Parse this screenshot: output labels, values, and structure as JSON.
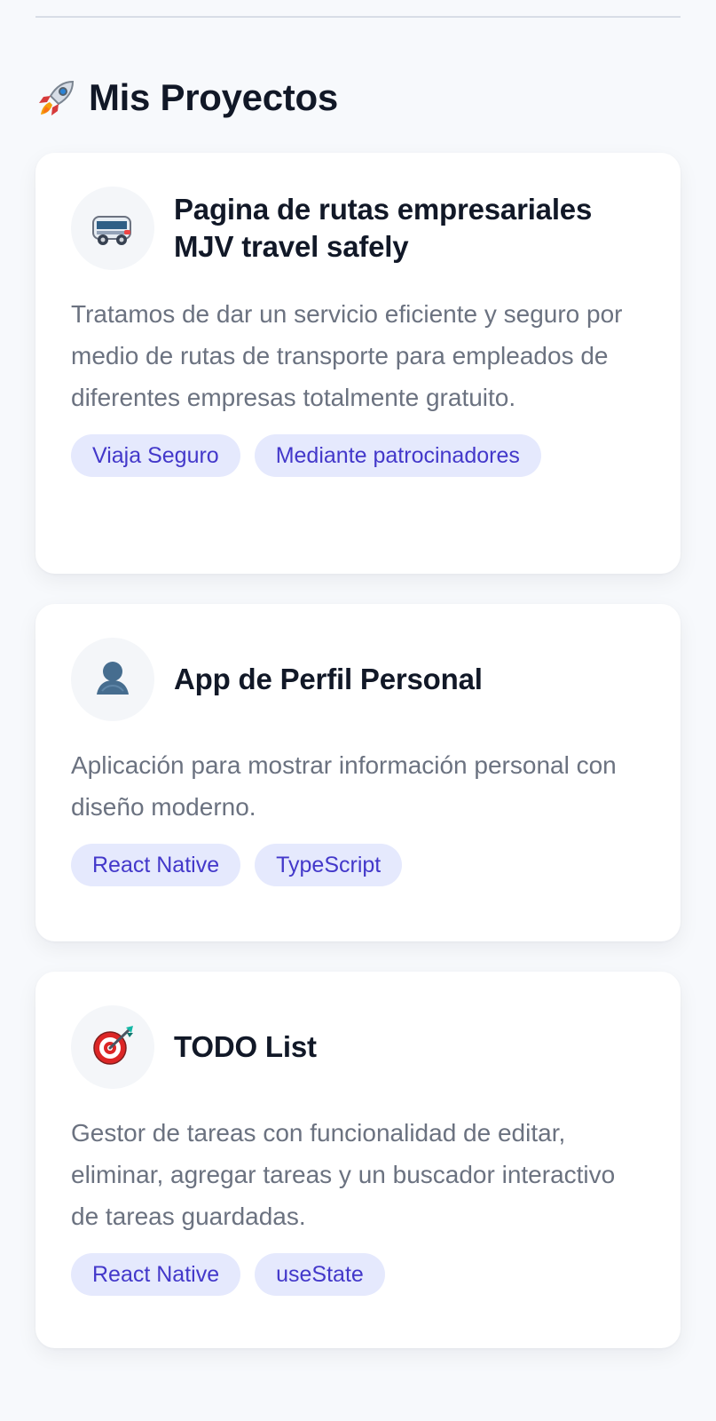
{
  "section": {
    "title": "Mis Proyectos",
    "icon": "rocket-icon"
  },
  "projects": [
    {
      "icon": "minibus-icon",
      "title": "Pagina de rutas empresariales MJV travel safely",
      "description": "Tratamos de dar un servicio eficiente y seguro por medio de rutas de transporte para empleados de diferentes empresas totalmente gratuito.",
      "tags": [
        "Viaja Seguro",
        "Mediante patrocinadores"
      ]
    },
    {
      "icon": "person-silhouette-icon",
      "title": "App de Perfil Personal",
      "description": "Aplicación para mostrar información personal con diseño moderno.",
      "tags": [
        "React Native",
        "TypeScript"
      ]
    },
    {
      "icon": "target-icon",
      "title": "TODO List",
      "description": "Gestor de tareas con funcionalidad de editar, eliminar, agregar tareas y un buscador interactivo de tareas guardadas.",
      "tags": [
        "React Native",
        "useState"
      ]
    }
  ],
  "colors": {
    "background": "#f7f9fc",
    "card": "#ffffff",
    "title": "#111827",
    "description": "#6b7280",
    "tag_background": "#e5e9fd",
    "tag_text": "#4338ca"
  }
}
